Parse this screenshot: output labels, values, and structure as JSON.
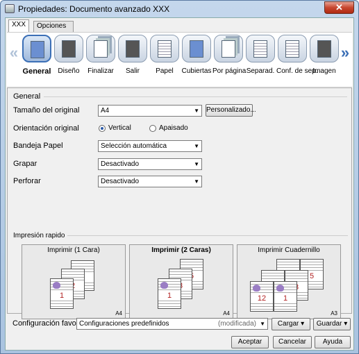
{
  "window": {
    "title": "Propiedades: Documento avanzado XXX",
    "close_label": "✕"
  },
  "tabs": [
    {
      "label": "XXX"
    },
    {
      "label": "Opciones avanzadas"
    }
  ],
  "toolbar": {
    "left_arrow": "«",
    "right_arrow": "»",
    "items": [
      {
        "label": "General",
        "icon": "general-icon"
      },
      {
        "label": "Diseño",
        "icon": "layout-icon"
      },
      {
        "label": "Finalizar",
        "icon": "finish-icon"
      },
      {
        "label": "Salir",
        "icon": "output-icon"
      },
      {
        "label": "Papel",
        "icon": "paper-icon"
      },
      {
        "label": "Cubiertas",
        "icon": "cover-icon"
      },
      {
        "label": "Por página",
        "icon": "per-page-icon"
      },
      {
        "label": "Separad.",
        "icon": "separator-icon"
      },
      {
        "label": "Conf. de sep.",
        "icon": "separator-settings-icon"
      },
      {
        "label": "Imagen",
        "icon": "image-icon"
      }
    ]
  },
  "general": {
    "section_title": "General",
    "original_size_label": "Tamaño del original",
    "original_size_value": "A4",
    "custom_button": "Personalizado...",
    "orientation_label": "Orientación original",
    "orientation_vertical": "Vertical",
    "orientation_landscape": "Apaisado",
    "tray_label": "Bandeja Papel",
    "tray_value": "Selección automática",
    "staple_label": "Grapar",
    "staple_value": "Desactivado",
    "punch_label": "Perforar",
    "punch_value": "Desactivado"
  },
  "quick_print": {
    "title": "Impresión rapido",
    "cards": [
      {
        "title": "Imprimir (1 Cara)",
        "size": "A4",
        "pages": [
          "3",
          "2",
          "1"
        ]
      },
      {
        "title": "Imprimir (2 Caras)",
        "size": "A4",
        "pages": [
          "5",
          "3",
          "1"
        ]
      },
      {
        "title": "Imprimir Cuadernillo",
        "size": "A3",
        "pages": [
          "8",
          "5",
          "10",
          "3",
          "12",
          "1"
        ]
      }
    ]
  },
  "favorites": {
    "label": "Configuración favorita",
    "value": "Configuraciones predefinidos",
    "modified": "(modificada)",
    "load_button": "Cargar",
    "save_button": "Guardar"
  },
  "footer": {
    "ok": "Aceptar",
    "cancel": "Cancelar",
    "help": "Ayuda"
  }
}
